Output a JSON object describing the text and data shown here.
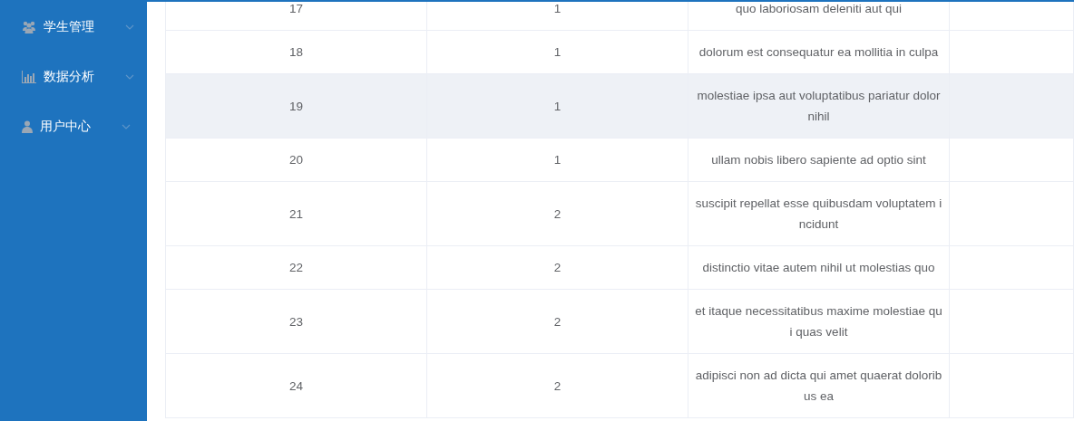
{
  "sidebar": {
    "items": [
      {
        "kind": "users",
        "label": "学生管理",
        "expanded": false
      },
      {
        "kind": "chart",
        "label": "数据分析",
        "expanded": false
      },
      {
        "kind": "user",
        "label": "用户中心",
        "expanded": false
      }
    ]
  },
  "table": {
    "rows": [
      {
        "cells": [
          "17",
          "1",
          "quo laboriosam deleniti aut qui"
        ],
        "highlighted": false
      },
      {
        "cells": [
          "18",
          "1",
          "dolorum est consequatur ea mollitia in culpa"
        ],
        "highlighted": false
      },
      {
        "cells": [
          "19",
          "1",
          "molestiae ipsa aut voluptatibus pariatur dolor nihil"
        ],
        "highlighted": true
      },
      {
        "cells": [
          "20",
          "1",
          "ullam nobis libero sapiente ad optio sint"
        ],
        "highlighted": false
      },
      {
        "cells": [
          "21",
          "2",
          "suscipit repellat esse quibusdam voluptatem incidunt"
        ],
        "highlighted": false
      },
      {
        "cells": [
          "22",
          "2",
          "distinctio vitae autem nihil ut molestias quo"
        ],
        "highlighted": false
      },
      {
        "cells": [
          "23",
          "2",
          "et itaque necessitatibus maxime molestiae qui quas velit"
        ],
        "highlighted": false
      },
      {
        "cells": [
          "24",
          "2",
          "adipisci non ad dicta qui amet quaerat doloribus ea"
        ],
        "highlighted": false
      }
    ]
  }
}
